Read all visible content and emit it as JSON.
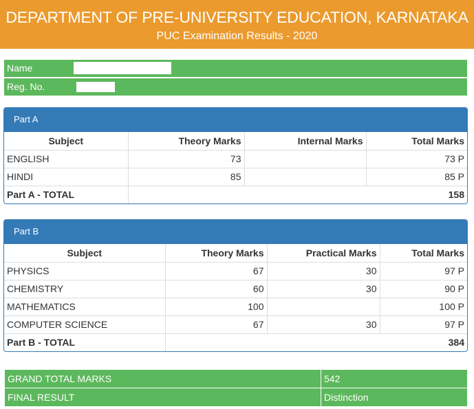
{
  "header": {
    "title": "DEPARTMENT OF PRE-UNIVERSITY EDUCATION, KARNATAKA",
    "subtitle": "PUC Examination Results - 2020"
  },
  "student": {
    "name_label": "Name",
    "regno_label": "Reg. No."
  },
  "part_a": {
    "heading": "Part A",
    "columns": [
      "Subject",
      "Theory Marks",
      "Internal Marks",
      "Total Marks"
    ],
    "rows": [
      {
        "subject": "ENGLISH",
        "theory": "73",
        "internal": "",
        "total": "73 P"
      },
      {
        "subject": "HINDI",
        "theory": "85",
        "internal": "",
        "total": "85 P"
      }
    ],
    "total_label": "Part A - TOTAL",
    "total_value": "158"
  },
  "part_b": {
    "heading": "Part B",
    "columns": [
      "Subject",
      "Theory Marks",
      "Practical Marks",
      "Total Marks"
    ],
    "rows": [
      {
        "subject": "PHYSICS",
        "theory": "67",
        "practical": "30",
        "total": "97 P"
      },
      {
        "subject": "CHEMISTRY",
        "theory": "60",
        "practical": "30",
        "total": "90 P"
      },
      {
        "subject": "MATHEMATICS",
        "theory": "100",
        "practical": "",
        "total": "100 P"
      },
      {
        "subject": "COMPUTER SCIENCE",
        "theory": "67",
        "practical": "30",
        "total": "97 P"
      }
    ],
    "total_label": "Part B - TOTAL",
    "total_value": "384"
  },
  "summary": {
    "grand_total_label": "GRAND TOTAL MARKS",
    "grand_total_value": "542",
    "final_result_label": "FINAL RESULT",
    "final_result_value": "Distinction"
  },
  "colors": {
    "banner": "#eb9a2e",
    "success_green": "#5cb85c",
    "panel_blue": "#337ab7"
  }
}
